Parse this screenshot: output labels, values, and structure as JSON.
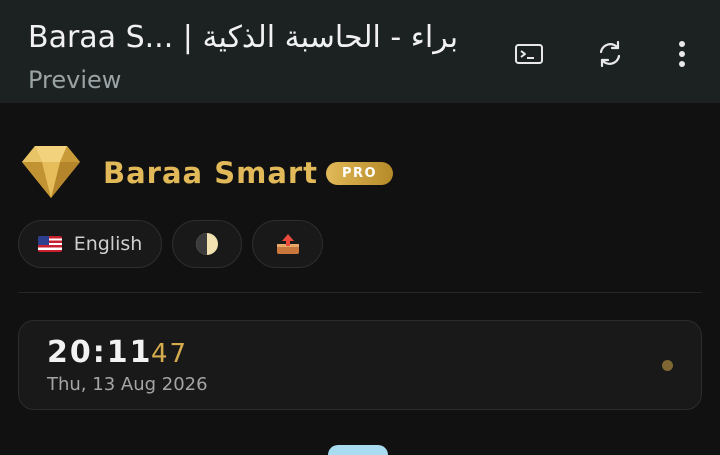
{
  "appbar": {
    "title": "Baraa S... | براء - الحاسبة الذكية",
    "subtitle": "Preview",
    "icons": [
      "terminal-icon",
      "refresh-icon",
      "more-vertical-icon"
    ]
  },
  "header": {
    "brand": "Baraa Smart",
    "badge": "PRO",
    "logo": "gold-diamond-icon",
    "accent_color": "#e2b958"
  },
  "controls": {
    "language_label": "English",
    "language_flag": "us-flag-icon",
    "theme_icon": "half-moon-icon",
    "export_icon": "outbox-tray-icon"
  },
  "clock": {
    "time": "20:11",
    "seconds": "47",
    "date": "Thu, 13 Aug 2026"
  }
}
